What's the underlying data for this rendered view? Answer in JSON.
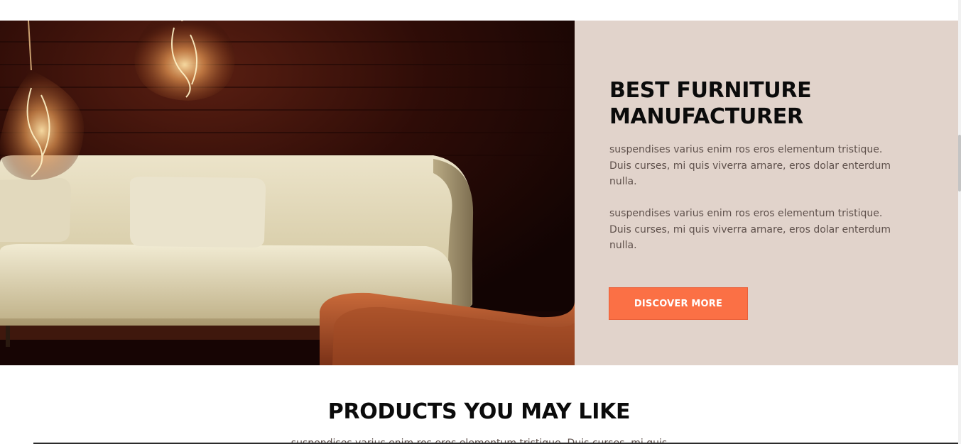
{
  "hero": {
    "image_alt": "cream sofa with pendant bulb lamps and orange chair",
    "title": "BEST FURNITURE MANUFACTURER",
    "paragraph_1": "suspendises varius enim ros eros elementum tristique. Duis curses, mi quis viverra arnare, eros dolar enterdum nulla.",
    "paragraph_2": "suspendises varius enim ros eros elementum tristique. Duis curses, mi quis viverra arnare, eros dolar enterdum nulla.",
    "button_label": "DISCOVER MORE"
  },
  "products": {
    "title": "PRODUCTS YOU MAY LIKE",
    "subtitle": "suspendises varius enim ros eros elementum tristique. Duis curses, mi quis"
  },
  "colors": {
    "panel_bg": "#e1d3cb",
    "accent": "#fb7045",
    "heading": "#0b0b0b",
    "body_text": "#5f514c"
  }
}
